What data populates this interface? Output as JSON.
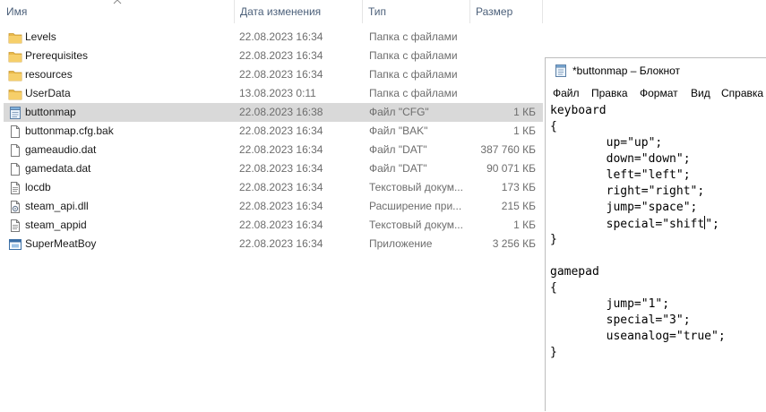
{
  "explorer": {
    "columns": {
      "name": "Имя",
      "date": "Дата изменения",
      "type": "Тип",
      "size": "Размер"
    },
    "rows": [
      {
        "icon": "folder-icon",
        "name": "Levels",
        "date": "22.08.2023 16:34",
        "type": "Папка с файлами",
        "size": ""
      },
      {
        "icon": "folder-icon",
        "name": "Prerequisites",
        "date": "22.08.2023 16:34",
        "type": "Папка с файлами",
        "size": ""
      },
      {
        "icon": "folder-icon",
        "name": "resources",
        "date": "22.08.2023 16:34",
        "type": "Папка с файлами",
        "size": ""
      },
      {
        "icon": "folder-icon",
        "name": "UserData",
        "date": "13.08.2023 0:11",
        "type": "Папка с файлами",
        "size": ""
      },
      {
        "icon": "config-file-icon",
        "name": "buttonmap",
        "date": "22.08.2023 16:38",
        "type": "Файл \"CFG\"",
        "size": "1 КБ",
        "selected": true
      },
      {
        "icon": "file-icon",
        "name": "buttonmap.cfg.bak",
        "date": "22.08.2023 16:34",
        "type": "Файл \"BAK\"",
        "size": "1 КБ"
      },
      {
        "icon": "file-icon",
        "name": "gameaudio.dat",
        "date": "22.08.2023 16:34",
        "type": "Файл \"DAT\"",
        "size": "387 760 КБ"
      },
      {
        "icon": "file-icon",
        "name": "gamedata.dat",
        "date": "22.08.2023 16:34",
        "type": "Файл \"DAT\"",
        "size": "90 071 КБ"
      },
      {
        "icon": "text-file-icon",
        "name": "locdb",
        "date": "22.08.2023 16:34",
        "type": "Текстовый докум...",
        "size": "173 КБ"
      },
      {
        "icon": "dll-file-icon",
        "name": "steam_api.dll",
        "date": "22.08.2023 16:34",
        "type": "Расширение при...",
        "size": "215 КБ"
      },
      {
        "icon": "text-file-icon",
        "name": "steam_appid",
        "date": "22.08.2023 16:34",
        "type": "Текстовый докум...",
        "size": "1 КБ"
      },
      {
        "icon": "application-icon",
        "name": "SuperMeatBoy",
        "date": "22.08.2023 16:34",
        "type": "Приложение",
        "size": "3 256 КБ"
      }
    ]
  },
  "notepad": {
    "title": "*buttonmap – Блокнот",
    "menu": [
      "Файл",
      "Правка",
      "Формат",
      "Вид",
      "Справка"
    ],
    "lines": [
      "keyboard",
      "{",
      "        up=\"up\";",
      "        down=\"down\";",
      "        left=\"left\";",
      "        right=\"right\";",
      "        jump=\"space\";",
      "        special=\"shift",
      "}",
      "",
      "gamepad",
      "{",
      "        jump=\"1\";",
      "        special=\"3\";",
      "        useanalog=\"true\";",
      "}"
    ],
    "caret_line_tail": "\";"
  },
  "colors": {
    "selected_row": "#d9d9d9",
    "folder": "#e8b84a",
    "header_text": "#4c607a",
    "meta_text": "#6d6d6d"
  }
}
